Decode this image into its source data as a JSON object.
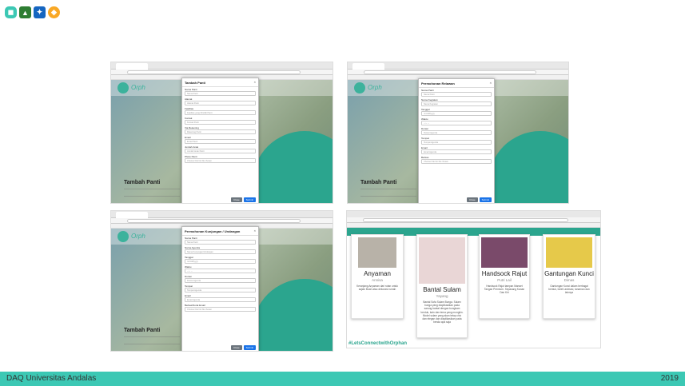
{
  "logos": [
    "orphan-logo",
    "unand-logo",
    "daq-logo",
    "university-logo"
  ],
  "screens": [
    {
      "modal_title": "Tambah Panti",
      "hero_title": "Tambah Panti",
      "fields": [
        {
          "label": "Nama Panti",
          "placeholder": "Nama Panti"
        },
        {
          "label": "Alamat",
          "placeholder": "Alamat Panti"
        },
        {
          "label": "Fasilitas",
          "placeholder": "Fasilitas yang Dimiliki Panti"
        },
        {
          "label": "Kontak",
          "placeholder": "Kontak Panti"
        },
        {
          "label": "Via Rekening",
          "placeholder": "Rekening Panti"
        },
        {
          "label": "Email",
          "placeholder": "Email Panti"
        },
        {
          "label": "Jumlah Anak",
          "placeholder": "Jumlah Anak Panti"
        },
        {
          "label": "Photo Panti",
          "placeholder": "Choose File  No file chosen"
        }
      ],
      "close_label": "Close",
      "submit_label": "Submit"
    },
    {
      "modal_title": "Permohonan Relawan",
      "hero_title": "Tambah Panti",
      "fields": [
        {
          "label": "Nama Panti",
          "placeholder": "Nama Panti"
        },
        {
          "label": "Nama Kegiatan",
          "placeholder": "Nama Kegiatan"
        },
        {
          "label": "Tanggal",
          "placeholder": "mm/dd/yyyy"
        },
        {
          "label": "Waktu",
          "placeholder": "--:-- --"
        },
        {
          "label": "Durasi",
          "placeholder": "Durasi Agenda"
        },
        {
          "label": "Tempat",
          "placeholder": "Tempat Agenda"
        },
        {
          "label": "Email",
          "placeholder": "Email Agenda"
        },
        {
          "label": "Berkas",
          "placeholder": "Choose File  No file chosen"
        }
      ],
      "close_label": "Close",
      "submit_label": "Submit"
    },
    {
      "modal_title": "Permohonan Kunjungan / Undangan",
      "hero_title": "Tambah Panti",
      "fields": [
        {
          "label": "Nama Panti",
          "placeholder": "Nama Panti"
        },
        {
          "label": "Nama Agenda",
          "placeholder": "Nama Kunjungan/Undangan"
        },
        {
          "label": "Tanggal",
          "placeholder": "mm/dd/yyyy"
        },
        {
          "label": "Waktu",
          "placeholder": "--:-- --"
        },
        {
          "label": "Durasi",
          "placeholder": "Durasi Agenda"
        },
        {
          "label": "Tempat",
          "placeholder": "Tempat Agenda"
        },
        {
          "label": "Email",
          "placeholder": "Email Agenda"
        },
        {
          "label": "Berkas/Surat Email",
          "placeholder": "Choose File  No file chosen"
        }
      ],
      "close_label": "Close",
      "submit_label": "Submit"
    }
  ],
  "cards": [
    {
      "title": "Anyaman",
      "sub": "Annisa",
      "desc": "Keranjang Anyaman dari rotan untuk sajian Buah atau dekorasi rumah",
      "color": "#b8b2a8"
    },
    {
      "title": "Bantal Sulam",
      "sub": "Yayang",
      "desc": "Bantal Sofa Sulam Bunga. Sulam bunga yang diaplikasikan pada sarung bantal dengan bongkam bentuk, kain dan tema yang mungkin. Model sulam yang akan tetap chic dan elegan dan diaplikasikan pada benda apa saja",
      "color": "#e9d6d6"
    },
    {
      "title": "Handsock Rajut",
      "sub": "Putri Lail",
      "desc": "Handsock Rajut tampan Manset Tangan Premium. Sepasang Kanan Dan Kiri",
      "color": "#7a4a6a"
    },
    {
      "title": "Gantungan Kunci",
      "sub": "Dimas",
      "desc": "Gantungan Kunci dalam berbagai bentuk, boleh animasi, tanaman dan lainnya",
      "color": "#e6c94a"
    }
  ],
  "hashtag": "#LetsConnectwithOrphan",
  "footer": {
    "left": "DAQ Universitas Andalas",
    "right": "2019"
  }
}
